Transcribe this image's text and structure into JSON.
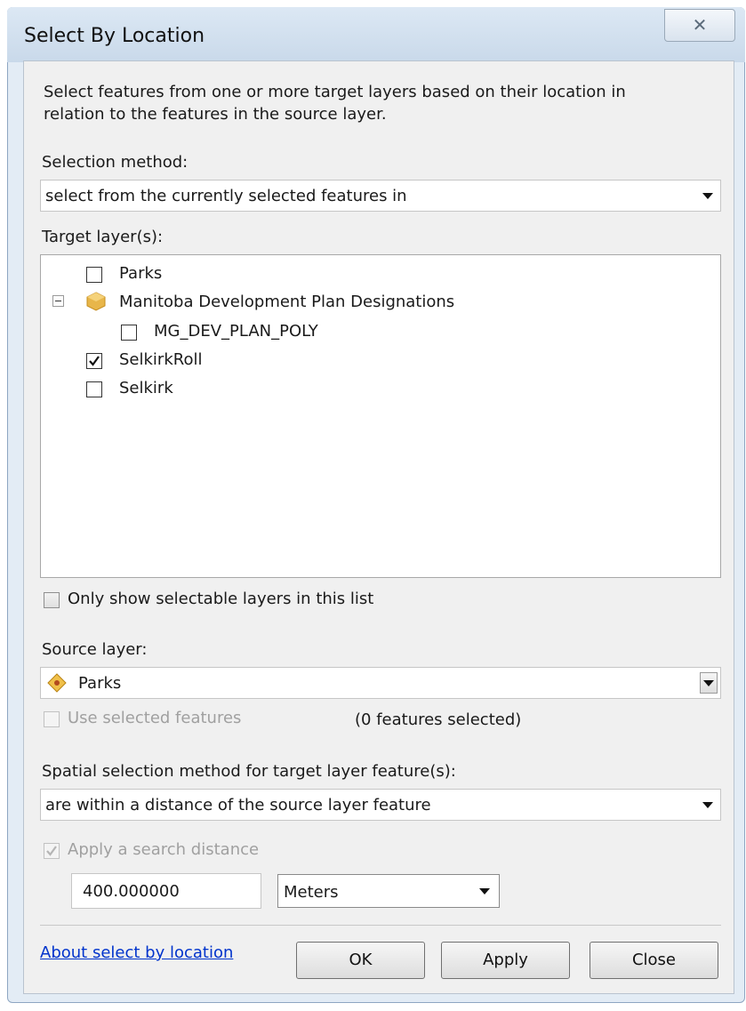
{
  "window": {
    "title": "Select By Location",
    "close_glyph": "✕"
  },
  "description": {
    "line1": "Select features from one or more target layers based on their location in",
    "line2": "relation to the features in the source layer."
  },
  "selection_method": {
    "label": "Selection method:",
    "value": "select from the currently selected features in"
  },
  "target_layers": {
    "label": "Target layer(s):",
    "items": [
      {
        "label": "Parks",
        "checked": false
      },
      {
        "label": "Manitoba Development Plan Designations",
        "group": true,
        "expanded": true,
        "icon": "group-layer-icon"
      },
      {
        "label": "MG_DEV_PLAN_POLY",
        "checked": false
      },
      {
        "label": "SelkirkRoll",
        "checked": true
      },
      {
        "label": "Selkirk",
        "checked": false
      }
    ]
  },
  "only_selectable": {
    "label": "Only show selectable layers in this list",
    "checked": false
  },
  "source_layer": {
    "label": "Source layer:",
    "value": "Parks",
    "icon": "point-layer-icon"
  },
  "use_selected": {
    "label": "Use selected features",
    "checked": false,
    "enabled": false,
    "count_text": "(0 features selected)"
  },
  "spatial_method": {
    "label": "Spatial selection method for target layer feature(s):",
    "value": "are within a distance of the source layer feature"
  },
  "search_distance": {
    "label": "Apply a search distance",
    "checked": true,
    "enabled": false,
    "value": "400.000000",
    "unit": "Meters"
  },
  "footer": {
    "help_link": "About select by location",
    "ok": "OK",
    "apply": "Apply",
    "close": "Close"
  },
  "colors": {
    "link": "#0033cc",
    "frame": "#e3ecf5",
    "client": "#f0f0f0"
  }
}
